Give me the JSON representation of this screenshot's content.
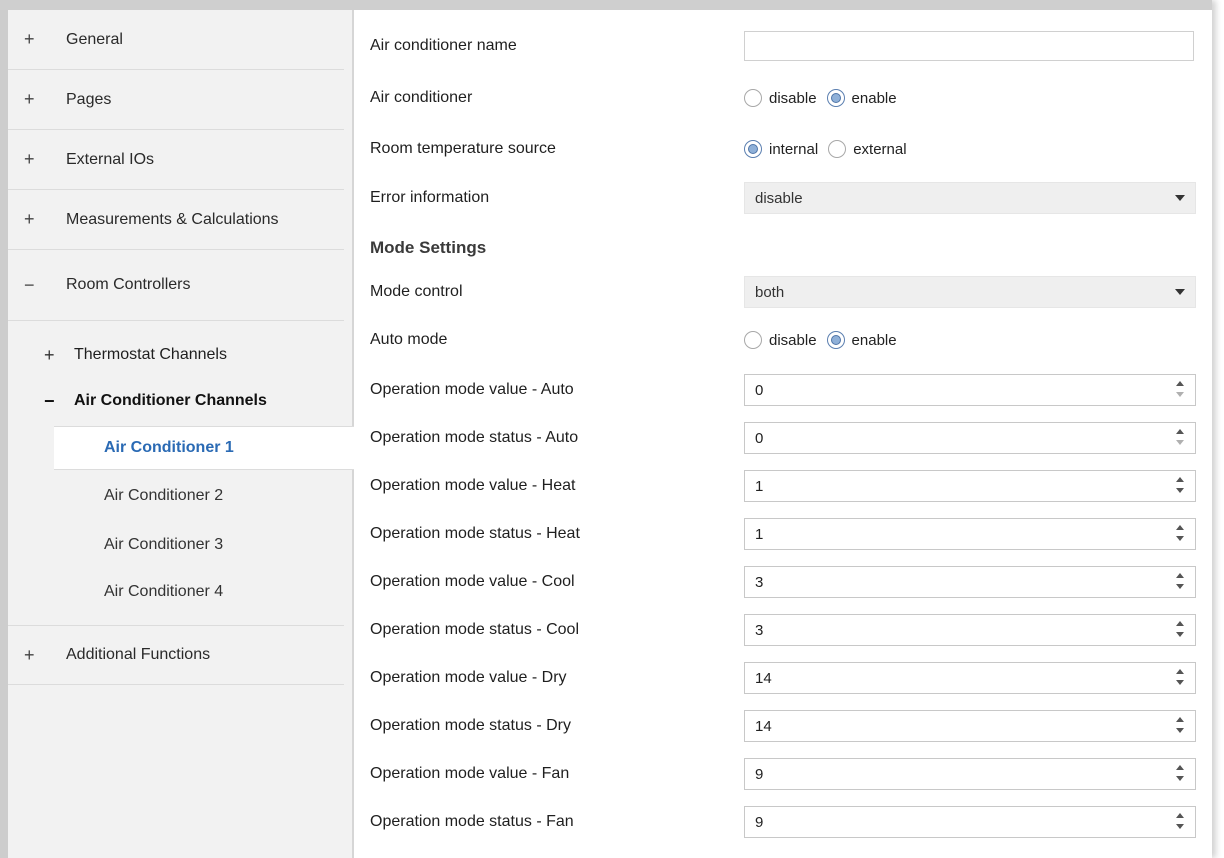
{
  "sidebar": {
    "items": [
      {
        "sign": "+",
        "label": "General"
      },
      {
        "sign": "+",
        "label": "Pages"
      },
      {
        "sign": "+",
        "label": "External IOs"
      },
      {
        "sign": "+",
        "label": "Measurements & Calculations"
      },
      {
        "sign": "−",
        "label": "Room Controllers"
      }
    ],
    "sub_items": [
      {
        "sign": "+",
        "label": "Thermostat Channels"
      },
      {
        "sign": "−",
        "label": "Air Conditioner Channels"
      }
    ],
    "channels": [
      {
        "label": "Air Conditioner 1",
        "active": true
      },
      {
        "label": "Air Conditioner 2",
        "active": false
      },
      {
        "label": "Air Conditioner 3",
        "active": false
      },
      {
        "label": "Air Conditioner 4",
        "active": false
      }
    ],
    "bottom_item": {
      "sign": "+",
      "label": "Additional Functions"
    }
  },
  "main": {
    "air_conditioner_name": {
      "label": "Air conditioner name",
      "value": ""
    },
    "air_conditioner": {
      "label": "Air conditioner",
      "options": [
        "disable",
        "enable"
      ],
      "selected": "enable"
    },
    "room_temperature_source": {
      "label": "Room temperature source",
      "options": [
        "internal",
        "external"
      ],
      "selected": "internal"
    },
    "error_information": {
      "label": "Error information",
      "value": "disable"
    },
    "mode_settings_heading": "Mode Settings",
    "mode_control": {
      "label": "Mode control",
      "value": "both"
    },
    "auto_mode": {
      "label": "Auto mode",
      "options": [
        "disable",
        "enable"
      ],
      "selected": "enable"
    },
    "operation_fields": [
      {
        "label": "Operation mode value - Auto",
        "value": "0"
      },
      {
        "label": "Operation mode status - Auto",
        "value": "0"
      },
      {
        "label": "Operation mode value - Heat",
        "value": "1"
      },
      {
        "label": "Operation mode status - Heat",
        "value": "1"
      },
      {
        "label": "Operation mode value - Cool",
        "value": "3"
      },
      {
        "label": "Operation mode status - Cool",
        "value": "3"
      },
      {
        "label": "Operation mode value - Dry",
        "value": "14"
      },
      {
        "label": "Operation mode status - Dry",
        "value": "14"
      },
      {
        "label": "Operation mode value - Fan",
        "value": "9"
      },
      {
        "label": "Operation mode status - Fan",
        "value": "9"
      }
    ]
  },
  "colors": {
    "active_channel": "#2a6ab4",
    "sidebar_bg": "#f2f2f2",
    "radio_checked": "#8fb0d8"
  }
}
